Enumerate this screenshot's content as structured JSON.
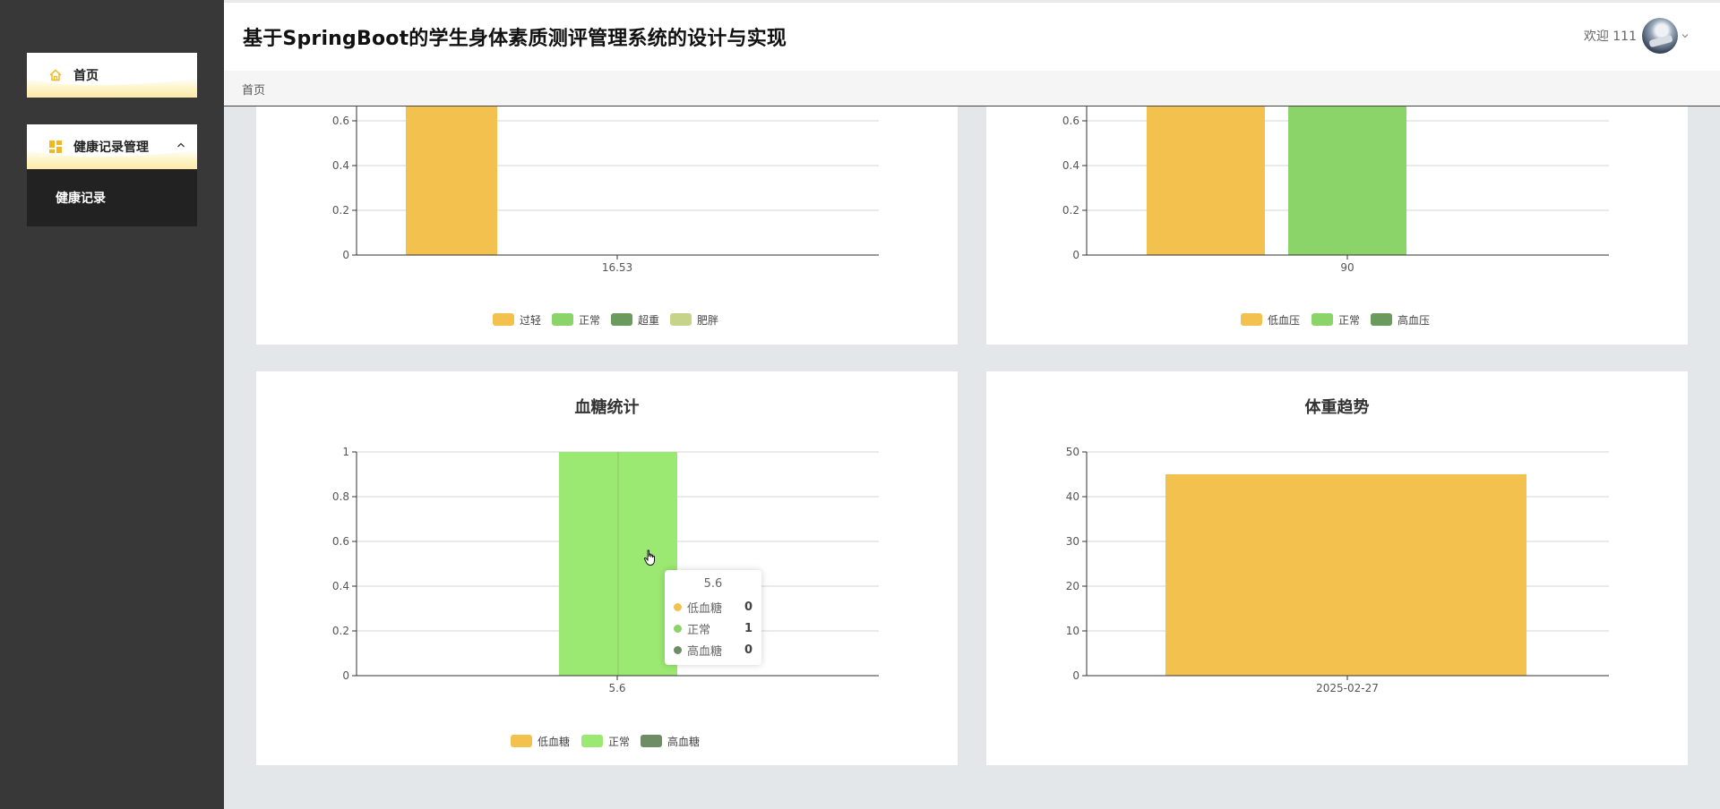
{
  "app": {
    "title": "基于SpringBoot的学生身体素质测评管理系统的设计与实现"
  },
  "sidebar": {
    "items": [
      {
        "label": "首页",
        "icon": "home-icon"
      },
      {
        "label": "健康记录管理",
        "icon": "grid-icon",
        "expanded": true,
        "children": [
          {
            "label": "健康记录"
          }
        ]
      }
    ]
  },
  "header": {
    "welcome": "欢迎 111"
  },
  "breadcrumb": {
    "current": "首页"
  },
  "colors": {
    "yellow": "#f2c14e",
    "green": "#8ad46a",
    "dark_green": "#6a9a5c",
    "light_green": "#c6d48a",
    "bright_green": "#9be872",
    "grey_green": "#6e8c66"
  },
  "tooltip": {
    "title": "5.6",
    "rows": [
      {
        "name": "低血糖",
        "value": "0",
        "color": "#f2c14e"
      },
      {
        "name": "正常",
        "value": "1",
        "color": "#8ad46a"
      },
      {
        "name": "高血糖",
        "value": "0",
        "color": "#6e8c66"
      }
    ]
  },
  "chart_data": [
    {
      "id": "bmi",
      "type": "bar",
      "title": "",
      "categories": [
        "16.53"
      ],
      "series": [
        {
          "name": "过轻",
          "values": [
            1
          ],
          "color": "#f2c14e"
        },
        {
          "name": "正常",
          "values": [
            0
          ],
          "color": "#8ad46a"
        },
        {
          "name": "超重",
          "values": [
            0
          ],
          "color": "#6a9a5c"
        },
        {
          "name": "肥胖",
          "values": [
            0
          ],
          "color": "#c6d48a"
        }
      ],
      "y_ticks": [
        "0",
        "0.2",
        "0.4",
        "0.6"
      ],
      "ylim_visible": [
        0,
        0.6
      ],
      "legend": "bottom-center"
    },
    {
      "id": "blood-pressure",
      "type": "bar",
      "title": "",
      "categories": [
        "90"
      ],
      "series": [
        {
          "name": "低血压",
          "values": [
            1
          ],
          "color": "#f2c14e"
        },
        {
          "name": "正常",
          "values": [
            1
          ],
          "color": "#8ad46a"
        },
        {
          "name": "高血压",
          "values": [
            0
          ],
          "color": "#6a9a5c"
        }
      ],
      "y_ticks": [
        "0",
        "0.2",
        "0.4",
        "0.6"
      ],
      "ylim_visible": [
        0,
        0.6
      ],
      "legend": "bottom-center"
    },
    {
      "id": "blood-sugar",
      "type": "bar",
      "title": "血糖统计",
      "categories": [
        "5.6"
      ],
      "series": [
        {
          "name": "低血糖",
          "values": [
            0
          ],
          "color": "#f2c14e"
        },
        {
          "name": "正常",
          "values": [
            1
          ],
          "color": "#9be872"
        },
        {
          "name": "高血糖",
          "values": [
            0
          ],
          "color": "#6e8c66"
        }
      ],
      "y_ticks": [
        "0",
        "0.2",
        "0.4",
        "0.6",
        "0.8",
        "1"
      ],
      "ylim": [
        0,
        1
      ],
      "legend": "bottom-center"
    },
    {
      "id": "weight-trend",
      "type": "bar",
      "title": "体重趋势",
      "categories": [
        "2025-02-27"
      ],
      "series": [
        {
          "name": "",
          "values": [
            45
          ],
          "color": "#f2c14e"
        }
      ],
      "y_ticks": [
        "0",
        "10",
        "20",
        "30",
        "40",
        "50"
      ],
      "ylim": [
        0,
        50
      ],
      "legend": "none"
    }
  ]
}
